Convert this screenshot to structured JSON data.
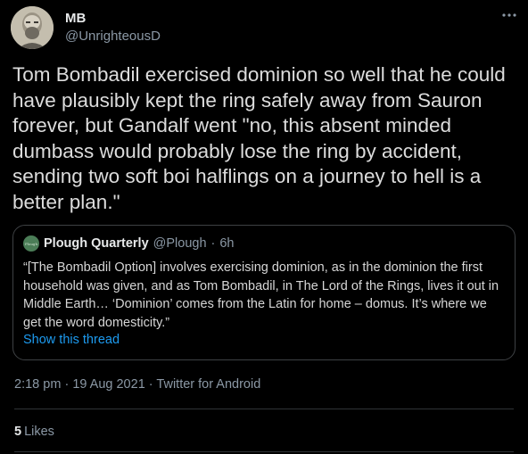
{
  "author": {
    "name": "MB",
    "handle": "@UnrighteousD"
  },
  "more_icon": "more-horizontal-icon",
  "tweet": {
    "text": "Tom Bombadil exercised dominion so well that he could have plausibly kept the ring safely away from Sauron forever, but Gandalf went \"no, this absent minded dumbass would probably lose the ring by accident, sending two soft boi halflings on a journey to hell is a better plan.\""
  },
  "quoted": {
    "name": "Plough Quarterly",
    "handle": "@Plough",
    "separator": "·",
    "time": "6h",
    "avatar_text": "Plough",
    "text": "“[The Bombadil Option] involves exercising dominion, as in the dominion the first household was given, and as Tom Bombadil, in The Lord of the Rings, lives it out in Middle Earth… ‘Dominion’ comes from the Latin for home – domus. It’s where we get the word domesticity.”",
    "show_thread": "Show this thread"
  },
  "meta": {
    "time": "2:18 pm",
    "date": "19 Aug 2021",
    "source": "Twitter for Android",
    "separator": "·"
  },
  "stats": {
    "likes_count": "5",
    "likes_label": "Likes"
  },
  "colors": {
    "background": "#000000",
    "link": "#1d9bf0",
    "secondary_text": "#8b98a5"
  }
}
